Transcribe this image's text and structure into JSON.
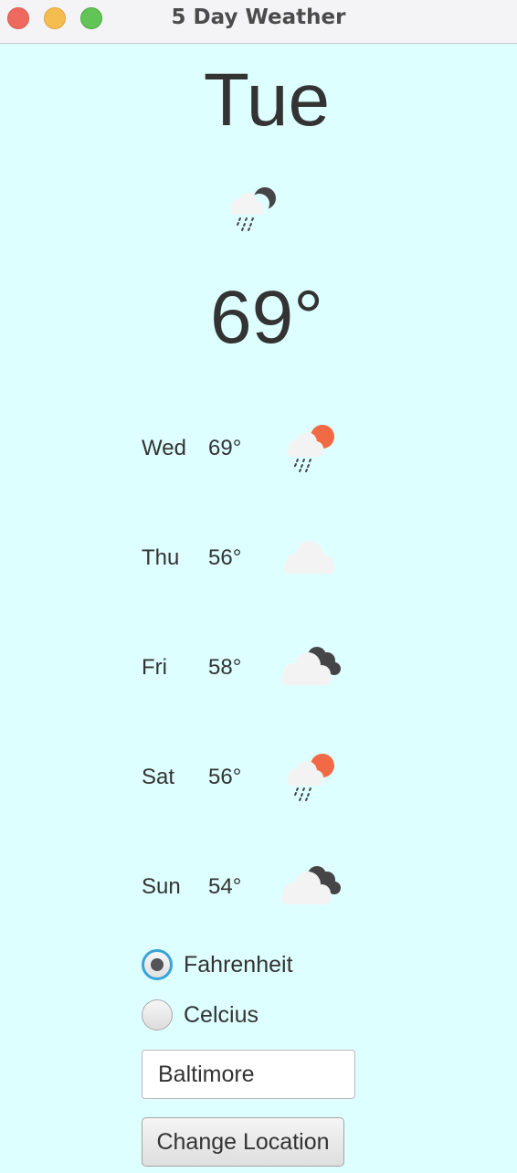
{
  "window": {
    "title": "5 Day Weather"
  },
  "today": {
    "day": "Tue",
    "temp": "69°",
    "icon": "night-rain-icon"
  },
  "forecast": [
    {
      "day": "Wed",
      "temp": "69°",
      "icon": "sun-rain-icon"
    },
    {
      "day": "Thu",
      "temp": "56°",
      "icon": "cloud-icon"
    },
    {
      "day": "Fri",
      "temp": "58°",
      "icon": "night-cloud-icon"
    },
    {
      "day": "Sat",
      "temp": "56°",
      "icon": "sun-rain-icon"
    },
    {
      "day": "Sun",
      "temp": "54°",
      "icon": "night-cloud-icon"
    }
  ],
  "units": {
    "options": [
      {
        "label": "Fahrenheit",
        "selected": true
      },
      {
        "label": "Celcius",
        "selected": false
      }
    ]
  },
  "location": {
    "value": "Baltimore"
  },
  "change_location_label": "Change Location",
  "colors": {
    "background": "#deffff",
    "text": "#333333",
    "sun": "#f06a46",
    "moon": "#454548",
    "cloud": "#f5f5f5",
    "radio_focus": "#3aa3d8"
  }
}
